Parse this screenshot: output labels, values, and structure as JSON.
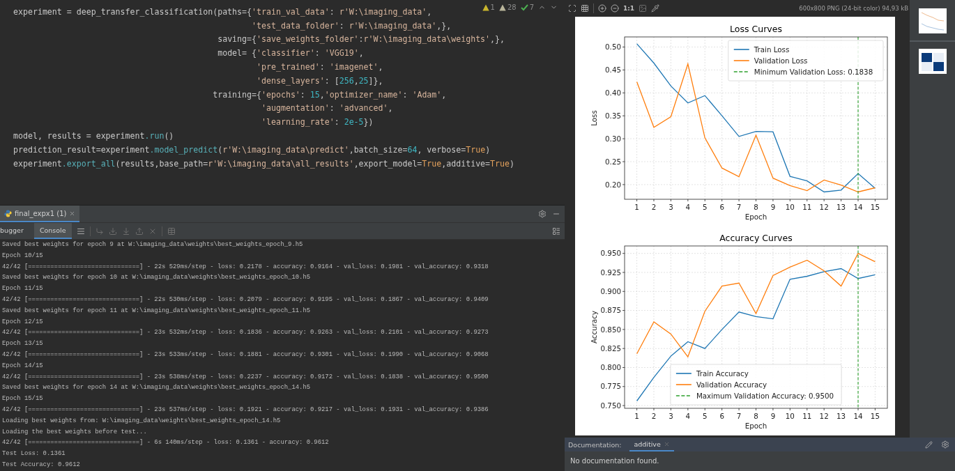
{
  "editor": {
    "inspections": [
      {
        "kind": "warning",
        "count": "1"
      },
      {
        "kind": "weak_warning",
        "count": "28"
      },
      {
        "kind": "typo",
        "count": "7"
      }
    ],
    "lines": [
      [
        {
          "kind": "plain",
          "text": "experiment = deep_transfer_classification(paths={"
        },
        {
          "kind": "string",
          "text": "'train_val_data'"
        },
        {
          "kind": "plain",
          "text": ": "
        },
        {
          "kind": "string",
          "text": "r'W:\\imaging_data'"
        },
        {
          "kind": "plain",
          "text": ","
        }
      ],
      [
        {
          "kind": "string",
          "text": "                                                 'test_data_folder'"
        },
        {
          "kind": "plain",
          "text": ": "
        },
        {
          "kind": "string",
          "text": "r'W:\\imaging_data'"
        },
        {
          "kind": "plain",
          "text": ",},"
        }
      ],
      [
        {
          "kind": "plain",
          "text": "                                          saving={"
        },
        {
          "kind": "string",
          "text": "'save_weights_folder'"
        },
        {
          "kind": "plain",
          "text": ":"
        },
        {
          "kind": "string",
          "text": "r'W:\\imaging_data\\weights'"
        },
        {
          "kind": "plain",
          "text": ",},"
        }
      ],
      [
        {
          "kind": "plain",
          "text": "                                          model= {"
        },
        {
          "kind": "string",
          "text": "'classifier'"
        },
        {
          "kind": "plain",
          "text": ": "
        },
        {
          "kind": "string",
          "text": "'VGG19'"
        },
        {
          "kind": "plain",
          "text": ","
        }
      ],
      [
        {
          "kind": "string",
          "text": "                                                  'pre_trained'"
        },
        {
          "kind": "plain",
          "text": ": "
        },
        {
          "kind": "string",
          "text": "'imagenet'"
        },
        {
          "kind": "plain",
          "text": ","
        }
      ],
      [
        {
          "kind": "string",
          "text": "                                                  'dense_layers'"
        },
        {
          "kind": "plain",
          "text": ": ["
        },
        {
          "kind": "number",
          "text": "256"
        },
        {
          "kind": "plain",
          "text": ","
        },
        {
          "kind": "number",
          "text": "25"
        },
        {
          "kind": "plain",
          "text": "]},"
        }
      ],
      [
        {
          "kind": "plain",
          "text": "                                         training={"
        },
        {
          "kind": "string",
          "text": "'epochs'"
        },
        {
          "kind": "plain",
          "text": ": "
        },
        {
          "kind": "number",
          "text": "15"
        },
        {
          "kind": "plain",
          "text": ","
        },
        {
          "kind": "string",
          "text": "'optimizer_name'"
        },
        {
          "kind": "plain",
          "text": ": "
        },
        {
          "kind": "string",
          "text": "'Adam'"
        },
        {
          "kind": "plain",
          "text": ","
        }
      ],
      [
        {
          "kind": "string",
          "text": "                                                   'augmentation'"
        },
        {
          "kind": "plain",
          "text": ": "
        },
        {
          "kind": "string",
          "text": "'advanced'"
        },
        {
          "kind": "plain",
          "text": ","
        }
      ],
      [
        {
          "kind": "string",
          "text": "                                                   'learning_rate'"
        },
        {
          "kind": "plain",
          "text": ": "
        },
        {
          "kind": "number",
          "text": "2e-5"
        },
        {
          "kind": "plain",
          "text": "})"
        }
      ],
      [
        {
          "kind": "plain",
          "text": "model, results = experiment"
        },
        {
          "kind": "method",
          "text": ".run"
        },
        {
          "kind": "plain",
          "text": "()"
        }
      ],
      [
        {
          "kind": "plain",
          "text": "prediction_result=experiment"
        },
        {
          "kind": "method",
          "text": ".model_predict"
        },
        {
          "kind": "plain",
          "text": "("
        },
        {
          "kind": "string",
          "text": "r'W:\\imaging_data\\predict'"
        },
        {
          "kind": "plain",
          "text": ",batch_size="
        },
        {
          "kind": "number",
          "text": "64"
        },
        {
          "kind": "plain",
          "text": ", verbose="
        },
        {
          "kind": "keyword",
          "text": "True"
        },
        {
          "kind": "plain",
          "text": ")"
        }
      ],
      [
        {
          "kind": "plain",
          "text": "experiment"
        },
        {
          "kind": "method",
          "text": ".export_all"
        },
        {
          "kind": "plain",
          "text": "(results,base_path="
        },
        {
          "kind": "string",
          "text": "r'W:\\imaging_data\\all_results'"
        },
        {
          "kind": "plain",
          "text": ",export_model="
        },
        {
          "kind": "keyword",
          "text": "True"
        },
        {
          "kind": "plain",
          "text": ",additive="
        },
        {
          "kind": "keyword",
          "text": "True"
        },
        {
          "kind": "plain",
          "text": ")"
        }
      ]
    ]
  },
  "run_panel": {
    "run_tab": {
      "label": "final_expx1 (1)",
      "selected": true
    },
    "tabs": [
      {
        "label": "bugger",
        "selected": false
      },
      {
        "label": "Console",
        "selected": true
      }
    ],
    "console_lines": [
      "Saved best weights for epoch 9 at W:\\imaging_data\\weights\\best_weights_epoch_9.h5",
      "Epoch 10/15",
      "42/42 [==============================] - 22s 529ms/step - loss: 0.2178 - accuracy: 0.9164 - val_loss: 0.1981 - val_accuracy: 0.9318",
      "Saved best weights for epoch 10 at W:\\imaging_data\\weights\\best_weights_epoch_10.h5",
      "Epoch 11/15",
      "42/42 [==============================] - 22s 530ms/step - loss: 0.2079 - accuracy: 0.9195 - val_loss: 0.1867 - val_accuracy: 0.9409",
      "Saved best weights for epoch 11 at W:\\imaging_data\\weights\\best_weights_epoch_11.h5",
      "Epoch 12/15",
      "42/42 [==============================] - 23s 532ms/step - loss: 0.1836 - accuracy: 0.9263 - val_loss: 0.2101 - val_accuracy: 0.9273",
      "Epoch 13/15",
      "42/42 [==============================] - 23s 533ms/step - loss: 0.1881 - accuracy: 0.9301 - val_loss: 0.1990 - val_accuracy: 0.9068",
      "Epoch 14/15",
      "42/42 [==============================] - 23s 538ms/step - loss: 0.2237 - accuracy: 0.9172 - val_loss: 0.1838 - val_accuracy: 0.9500",
      "Saved best weights for epoch 14 at W:\\imaging_data\\weights\\best_weights_epoch_14.h5",
      "Epoch 15/15",
      "42/42 [==============================] - 23s 537ms/step - loss: 0.1921 - accuracy: 0.9217 - val_loss: 0.1931 - val_accuracy: 0.9386",
      "Loading best weights from: W:\\imaging_data\\weights\\best_weights_epoch_14.h5",
      "Loading the best weights before test...",
      "42/42 [==============================] - 6s 140ms/step - loss: 0.1361 - accuracy: 0.9612",
      "Test Loss: 0.1361",
      "Test Accuracy: 0.9612"
    ]
  },
  "image_viewer": {
    "zoom_label": "1:1",
    "info": "600x800 PNG (24-bit color) 94,93 kB",
    "charts": [
      {
        "chart_data": {
          "type": "line",
          "legend": "upper right",
          "grid": true,
          "title": "Loss Curves",
          "xlabel": "Epoch",
          "ylabel": "Loss",
          "x": [
            1,
            2,
            3,
            4,
            5,
            6,
            7,
            8,
            9,
            10,
            11,
            12,
            13,
            14,
            15
          ],
          "series": [
            {
              "name": "Train Loss",
              "color": "#1f77b4",
              "values": [
                0.507,
                0.465,
                0.415,
                0.378,
                0.394,
                0.35,
                0.305,
                0.316,
                0.315,
                0.218,
                0.208,
                0.184,
                0.188,
                0.224,
                0.192
              ]
            },
            {
              "name": "Validation Loss",
              "color": "#ff7f0e",
              "values": [
                0.424,
                0.325,
                0.348,
                0.463,
                0.302,
                0.236,
                0.217,
                0.308,
                0.214,
                0.198,
                0.187,
                0.21,
                0.199,
                0.184,
                0.193
              ]
            }
          ],
          "xlim": [
            0.28,
            15.72
          ],
          "ylim": [
            0.168,
            0.522
          ],
          "xticks": [
            1,
            2,
            3,
            4,
            5,
            6,
            7,
            8,
            9,
            10,
            11,
            12,
            13,
            14,
            15
          ],
          "yticks": [
            {
              "value": 0.2,
              "label": "0.20"
            },
            {
              "value": 0.25,
              "label": "0.25"
            },
            {
              "value": 0.3,
              "label": "0.30"
            },
            {
              "value": 0.35,
              "label": "0.35"
            },
            {
              "value": 0.4,
              "label": "0.40"
            },
            {
              "value": 0.45,
              "label": "0.45"
            },
            {
              "value": 0.5,
              "label": "0.50"
            }
          ],
          "ref_lines": [
            {
              "axis": "x",
              "value": 14,
              "color": "#2ca02c"
            }
          ],
          "annotations": [
            {
              "text": "Minimum Validation Loss: 0.1838"
            }
          ]
        }
      },
      {
        "chart_data": {
          "type": "line",
          "legend": "lower center",
          "grid": true,
          "title": "Accuracy Curves",
          "xlabel": "Epoch",
          "ylabel": "Accuracy",
          "x": [
            1,
            2,
            3,
            4,
            5,
            6,
            7,
            8,
            9,
            10,
            11,
            12,
            13,
            14,
            15
          ],
          "series": [
            {
              "name": "Train Accuracy",
              "color": "#1f77b4",
              "values": [
                0.756,
                0.787,
                0.815,
                0.834,
                0.825,
                0.85,
                0.873,
                0.867,
                0.864,
                0.916,
                0.92,
                0.926,
                0.93,
                0.917,
                0.922
              ]
            },
            {
              "name": "Validation Accuracy",
              "color": "#ff7f0e",
              "values": [
                0.818,
                0.86,
                0.844,
                0.814,
                0.874,
                0.907,
                0.911,
                0.871,
                0.921,
                0.932,
                0.941,
                0.927,
                0.907,
                0.95,
                0.939
              ]
            }
          ],
          "xlim": [
            0.28,
            15.72
          ],
          "ylim": [
            0.7464,
            0.9598
          ],
          "xticks": [
            1,
            2,
            3,
            4,
            5,
            6,
            7,
            8,
            9,
            10,
            11,
            12,
            13,
            14,
            15
          ],
          "yticks": [
            {
              "value": 0.75,
              "label": "0.750"
            },
            {
              "value": 0.775,
              "label": "0.775"
            },
            {
              "value": 0.8,
              "label": "0.800"
            },
            {
              "value": 0.825,
              "label": "0.825"
            },
            {
              "value": 0.85,
              "label": "0.850"
            },
            {
              "value": 0.875,
              "label": "0.875"
            },
            {
              "value": 0.9,
              "label": "0.900"
            },
            {
              "value": 0.925,
              "label": "0.925"
            },
            {
              "value": 0.95,
              "label": "0.950"
            }
          ],
          "ref_lines": [
            {
              "axis": "x",
              "value": 14,
              "color": "#2ca02c"
            }
          ],
          "annotations": [
            {
              "text": "Maximum Validation Accuracy: 0.9500"
            }
          ]
        }
      }
    ]
  },
  "documentation": {
    "label": "Documentation:",
    "tab": {
      "label": "additive",
      "selected": true
    },
    "message": "No documentation found."
  }
}
